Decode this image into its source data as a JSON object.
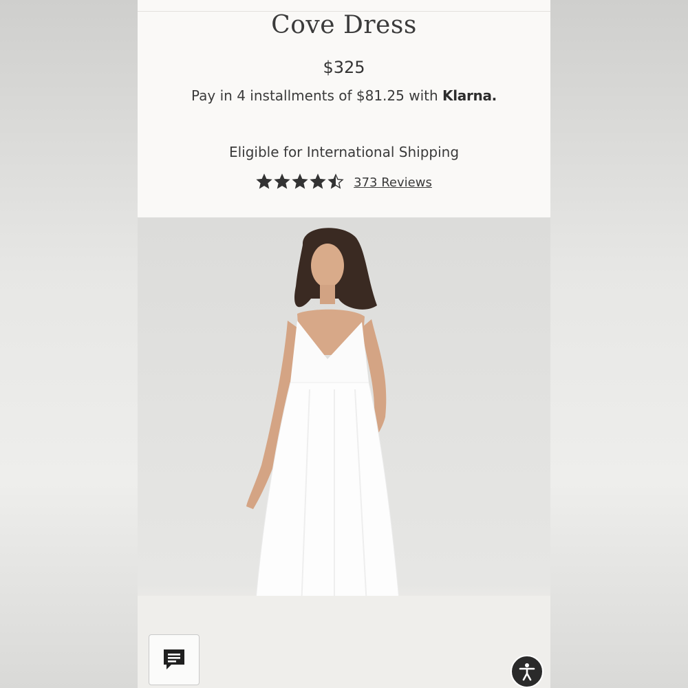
{
  "product": {
    "title": "Cove Dress",
    "price": "$325",
    "installments_prefix": "Pay in 4 installments of $81.25 with ",
    "installments_provider": "Klarna.",
    "shipping": "Eligible for International Shipping",
    "rating": {
      "stars": 4.5,
      "max_stars": 5,
      "reviews_label": "373 Reviews"
    }
  },
  "icons": {
    "chat": "chat-bubble-icon",
    "accessibility": "accessibility-icon",
    "star": "star-icon"
  },
  "colors": {
    "background": "#faf9f7",
    "text": "#3a3a3a",
    "star": "#333333",
    "photo_background": "#e3e3e1"
  }
}
